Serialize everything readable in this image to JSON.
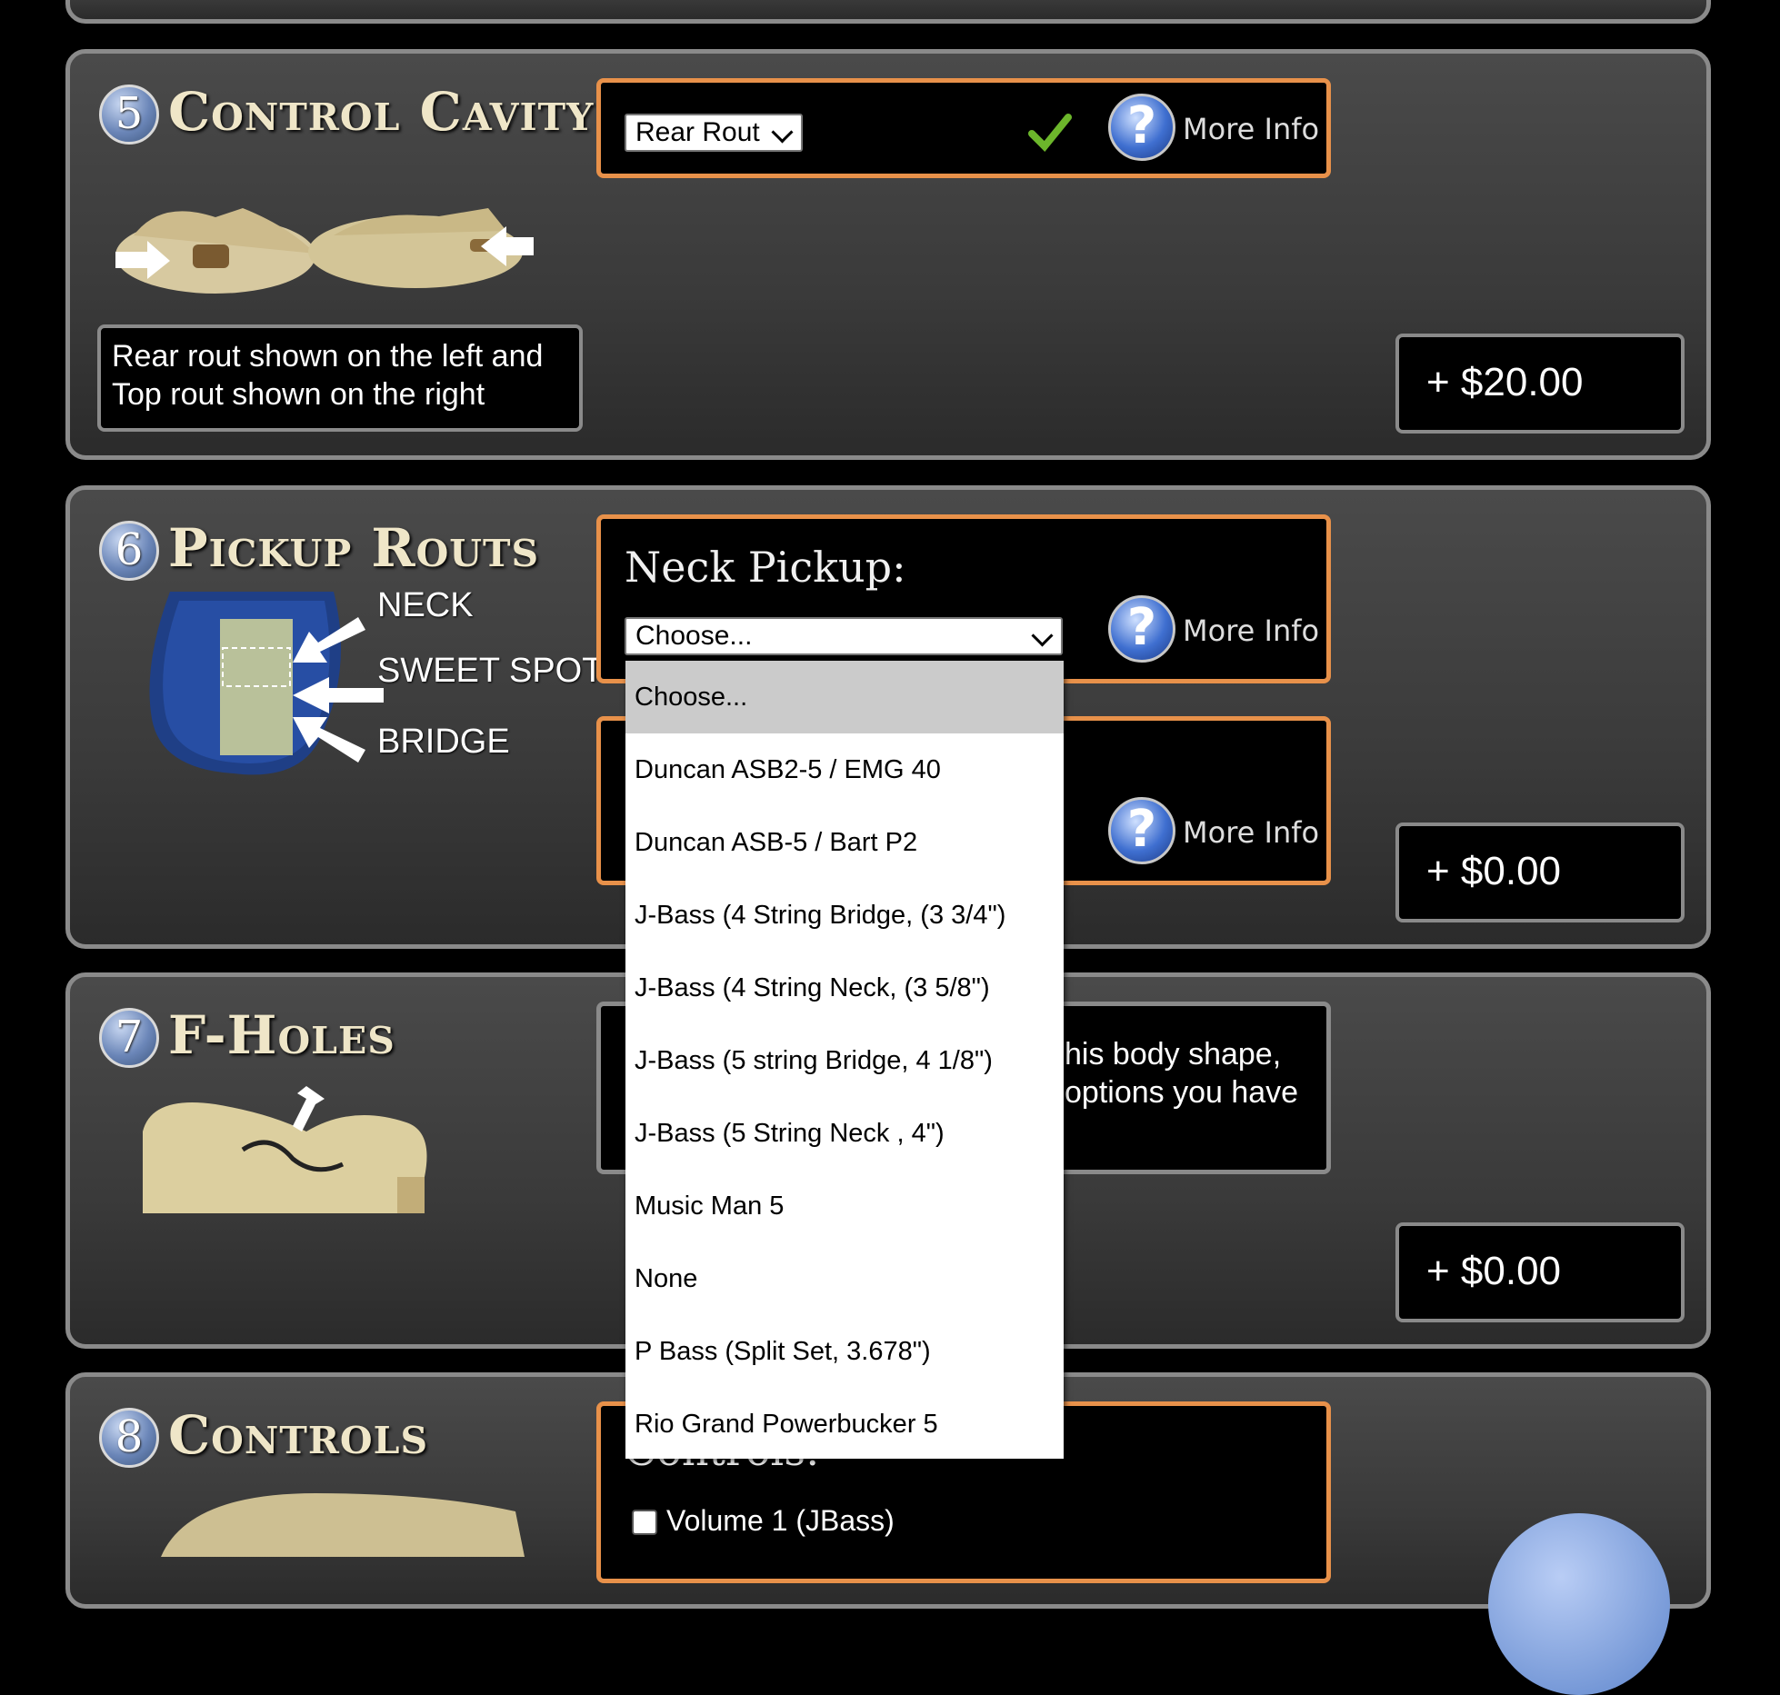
{
  "sections": {
    "control_cavity": {
      "number": "5",
      "title": "Control Cavity",
      "select_value": "Rear Rout",
      "more_info": "More Info",
      "caption_line1": "Rear rout shown on the left and",
      "caption_line2": "Top rout shown on the right",
      "price": "+ $20.00"
    },
    "pickup_routs": {
      "number": "6",
      "title": "Pickup Routs",
      "neck_label": "Neck Pickup:",
      "select_value": "Choose...",
      "more_info_1": "More Info",
      "more_info_2": "More Info",
      "diagram_neck": "NECK",
      "diagram_sweet": "SWEET SPOT",
      "diagram_bridge": "BRIDGE",
      "price": "+ $0.00"
    },
    "f_holes": {
      "number": "7",
      "title": "F-Holes",
      "text_line1": "his body shape,",
      "text_line2": "options you have",
      "price": "+ $0.00"
    },
    "controls": {
      "number": "8",
      "title": "Controls",
      "heading_partial": "Controls:",
      "checkbox_1": "Volume 1 (JBass)"
    }
  },
  "dropdown": {
    "options": [
      "Choose...",
      "Duncan ASB2-5 / EMG 40",
      "Duncan ASB-5 / Bart P2",
      "J-Bass (4 String Bridge, (3 3/4\")",
      "J-Bass (4 String Neck, (3 5/8\")",
      "J-Bass (5 string Bridge, 4 1/8\")",
      "J-Bass (5 String Neck , 4\")",
      "Music Man 5",
      "None",
      "P Bass (Split Set, 3.678\")",
      "Rio Grand Powerbucker 5"
    ],
    "selected_index": 0
  },
  "colors": {
    "accent_border": "#e8914a",
    "panel_border": "#8a8a8a",
    "checkmark": "#6cb62b"
  }
}
